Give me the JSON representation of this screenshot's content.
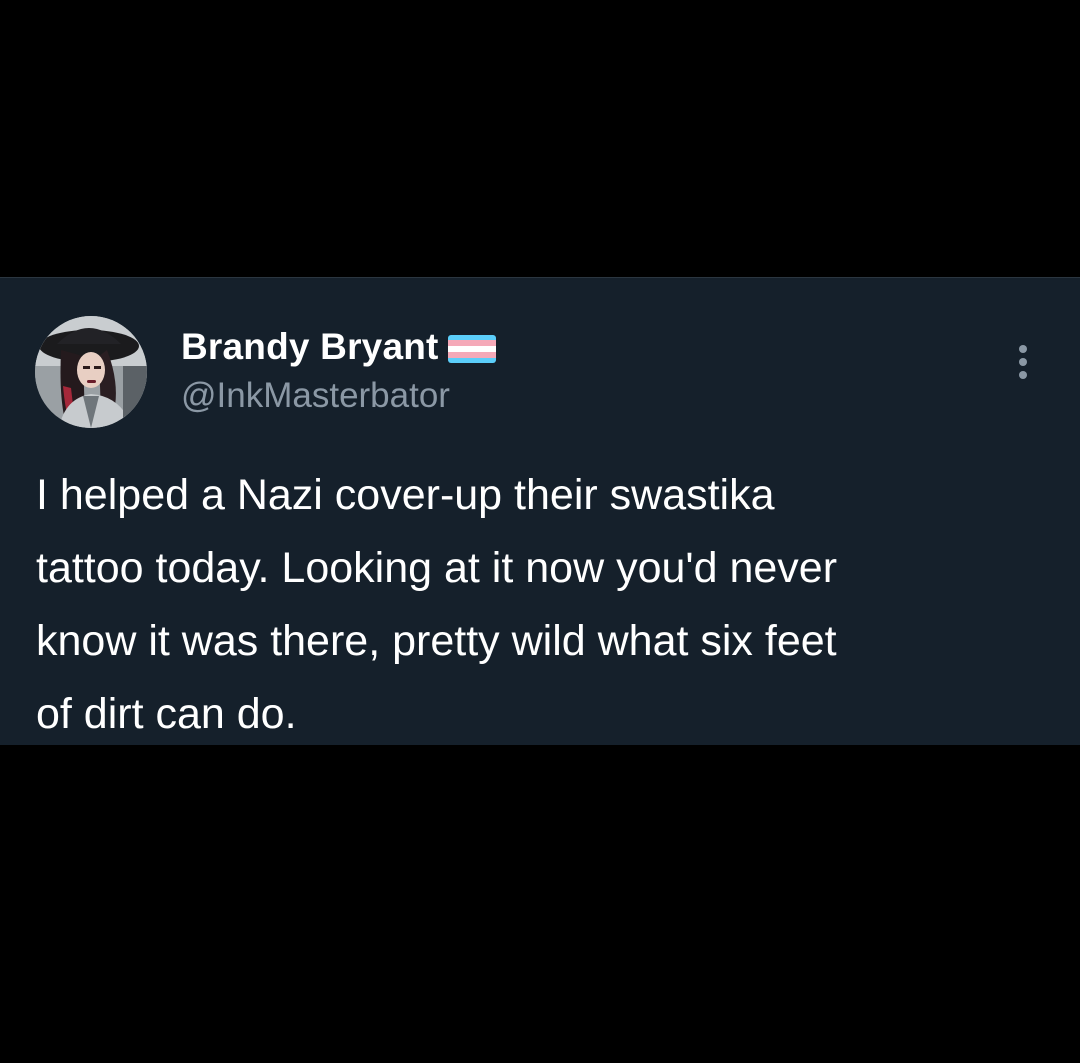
{
  "tweet": {
    "author": {
      "display_name": "Brandy Bryant",
      "handle": "@InkMasterbator",
      "badge": "transgender-flag-emoji",
      "avatar": "profile-photo"
    },
    "text": "I helped a Nazi cover-up their swastika\ntattoo today. Looking at it now you'd never\nknow it was there, pretty wild what six feet\nof dirt can do.",
    "more_icon": "more-vertical-icon"
  },
  "colors": {
    "page_background": "#000000",
    "card_background": "#15202b",
    "name_text": "#ffffff",
    "handle_text": "#8b98a5",
    "body_text": "#ffffff",
    "flag_blue": "#5bcefa",
    "flag_pink": "#f5a9b8",
    "flag_white": "#ffffff"
  }
}
